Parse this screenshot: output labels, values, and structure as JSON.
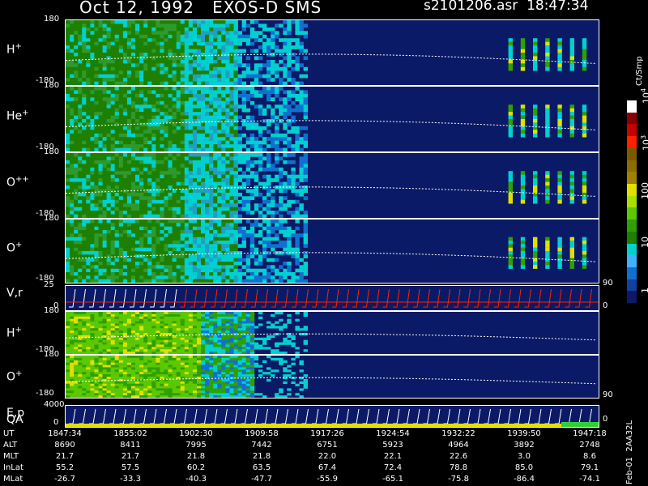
{
  "header": {
    "date": "Oct 12, 1992",
    "instrument": "EXOS-D SMS",
    "file": "s2101206.asr",
    "time": "18:47:34"
  },
  "panels": [
    {
      "id": "h1",
      "label": "H",
      "charge": "+",
      "ymax": "180",
      "ymin": "-180"
    },
    {
      "id": "he",
      "label": "He",
      "charge": "+",
      "ymax": "180",
      "ymin": "-180"
    },
    {
      "id": "opp",
      "label": "O",
      "charge": "++",
      "ymax": "180",
      "ymin": "-180"
    },
    {
      "id": "o1",
      "label": "O",
      "charge": "+",
      "ymax": "180",
      "ymin": "-180"
    },
    {
      "id": "vr",
      "label": "V,r",
      "ymax": "25",
      "ymin": "0"
    },
    {
      "id": "h2",
      "label": "H",
      "charge": "+",
      "ymax": "180",
      "ymin": "-180"
    },
    {
      "id": "o2",
      "label": "O",
      "charge": "+",
      "ymax": "180",
      "ymin": "-180"
    },
    {
      "id": "ep",
      "label": "E,p",
      "label2": "QA",
      "ymax": "4000",
      "ymin": "0"
    }
  ],
  "right_axis": {
    "upper": {
      "top": "90",
      "bottom": "0"
    },
    "lower": {
      "top": "90",
      "bottom": "0"
    }
  },
  "colorbar": {
    "unit": "Ct/Smp",
    "ticks": [
      "10",
      "10",
      "100",
      "10",
      "1"
    ],
    "exponents": [
      "4",
      "3",
      "",
      "",
      ""
    ],
    "colors": [
      "#ffffff",
      "#8a0000",
      "#c80000",
      "#ff2000",
      "#7a5a00",
      "#8c6e00",
      "#a08000",
      "#e0e000",
      "#a8e000",
      "#5cc800",
      "#30a000",
      "#1e8000",
      "#00d0d0",
      "#40b0ff",
      "#1070d0",
      "#1040a0",
      "#0b1a66"
    ]
  },
  "footer": {
    "side_label_1": "Feb-01",
    "side_label_2": "2AA32L",
    "rows": [
      {
        "name": "UT",
        "values": [
          "1847:34",
          "1855:02",
          "1902:30",
          "1909:58",
          "1917:26",
          "1924:54",
          "1932:22",
          "1939:50",
          "1947:18"
        ]
      },
      {
        "name": "ALT",
        "values": [
          "8690",
          "8411",
          "7995",
          "7442",
          "6751",
          "5923",
          "4964",
          "3892",
          "2748"
        ]
      },
      {
        "name": "MLT",
        "values": [
          "21.7",
          "21.7",
          "21.8",
          "21.8",
          "22.0",
          "22.1",
          "22.6",
          "3.0",
          "8.6"
        ]
      },
      {
        "name": "InLat",
        "values": [
          "55.2",
          "57.5",
          "60.2",
          "63.5",
          "67.4",
          "72.4",
          "78.8",
          "85.0",
          "79.1"
        ]
      },
      {
        "name": "MLat",
        "values": [
          "-26.7",
          "-33.3",
          "-40.3",
          "-47.7",
          "-55.9",
          "-65.1",
          "-75.8",
          "-86.4",
          "-74.1"
        ]
      }
    ]
  },
  "chart_data": {
    "type": "heatmap",
    "colors": {
      "background": "#0b1a66",
      "low": "#1040a0",
      "mid": "#00d0d0",
      "high": "#1e8000",
      "peak": "#e0e000"
    }
  }
}
